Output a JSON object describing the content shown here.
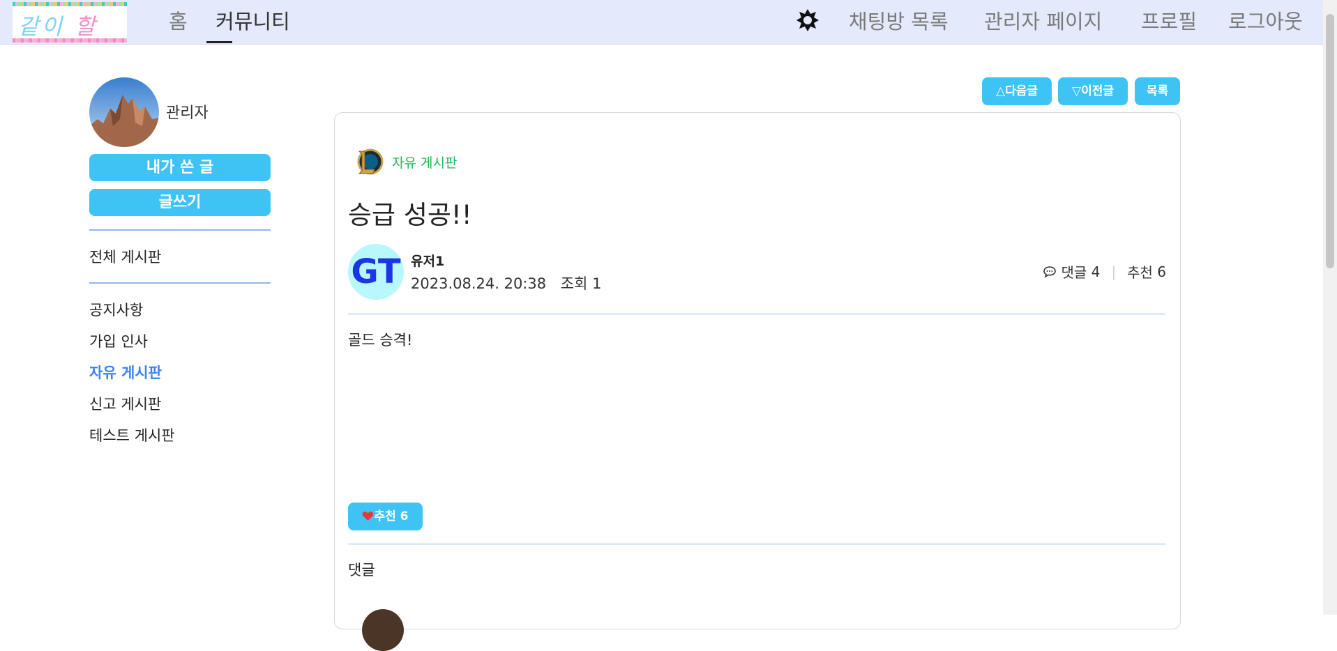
{
  "nav": {
    "logo_text": [
      "같이",
      "할래?"
    ],
    "home": "홈",
    "community": "커뮤니티",
    "chat_list": "채팅방 목록",
    "admin_page": "관리자 페이지",
    "profile": "프로필",
    "logout": "로그아웃",
    "theme_icon": "sun-icon"
  },
  "sidebar": {
    "username": "관리자",
    "my_posts_label": "내가 쓴 글",
    "write_label": "글쓰기",
    "all_boards": "전체 게시판",
    "boards": [
      "공지사항",
      "가입 인사",
      "자유 게시판",
      "신고 게시판",
      "테스트 게시판"
    ],
    "active_board": "자유 게시판"
  },
  "article_nav": {
    "next_label": "△다음글",
    "prev_label": "▽이전글",
    "list_label": "목록"
  },
  "post": {
    "board_name": "자유 게시판",
    "title": "승급 성공!!",
    "author_initials": "GT",
    "author_name": "유저1",
    "date": "2023.08.24. 20:38",
    "views_label": "조회",
    "views": "1",
    "comments_label": "댓글",
    "comments_count": "4",
    "likes_label": "추천",
    "likes_count": "6",
    "body": "골드 승격!",
    "like_button_label": "추천 6"
  },
  "comments": {
    "title": "댓글"
  },
  "colors": {
    "accent": "#3fc3f4",
    "active_link": "#3b82f6",
    "board_green": "#1db954",
    "nav_bg": "#e4e9fb",
    "divider": "#8db7ef"
  }
}
